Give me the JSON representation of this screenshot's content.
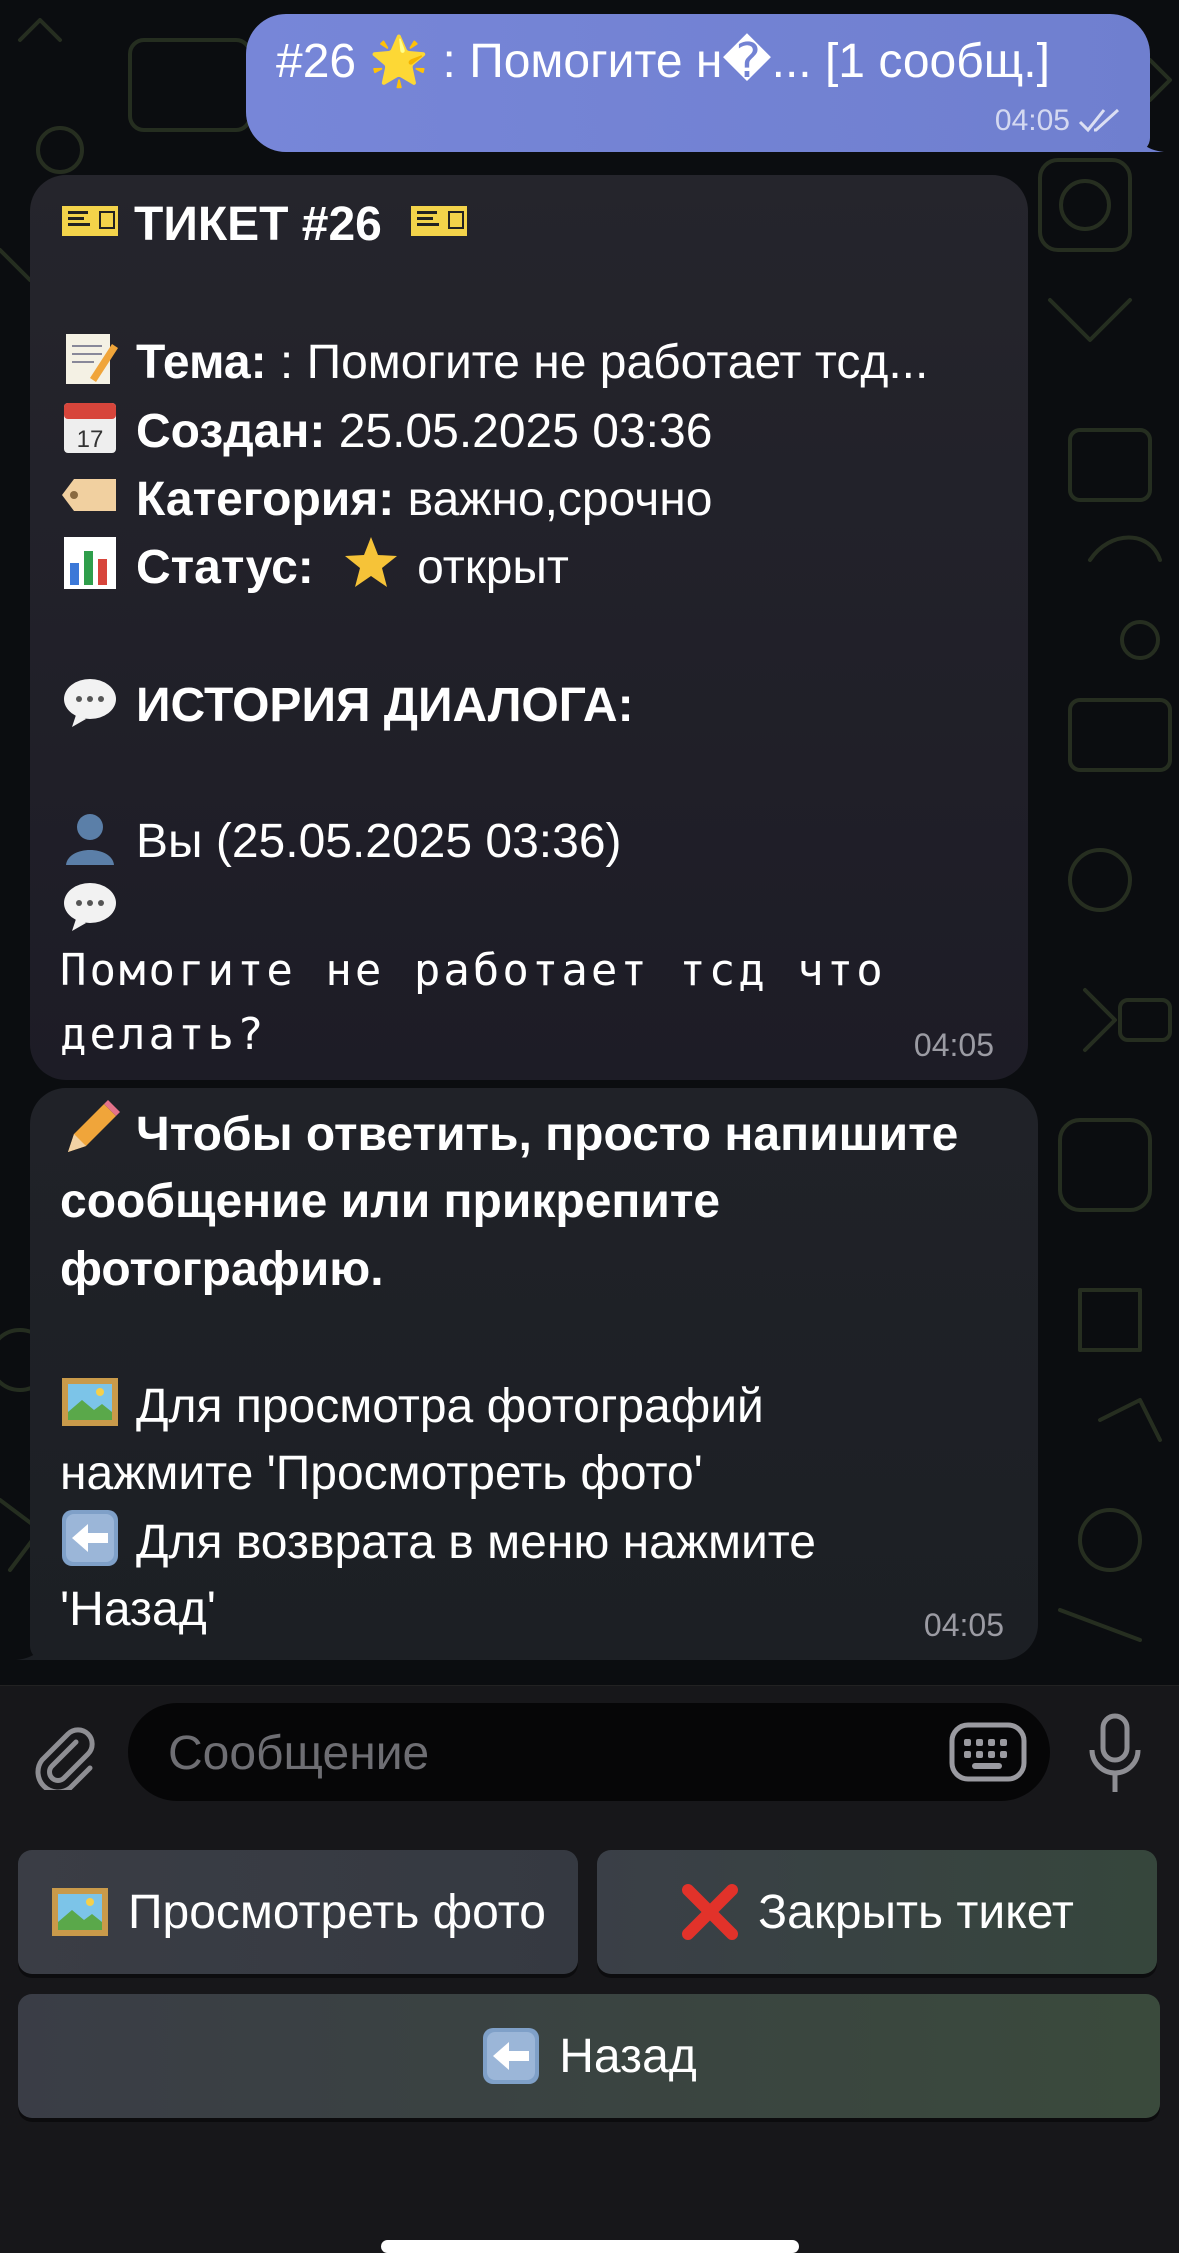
{
  "outgoing": {
    "text": "#26 🌟 : Помогите н�... [1 сообщ.]",
    "time": "04:05",
    "status_icon": "double-check-icon"
  },
  "ticket_message": {
    "title": "ТИКЕТ #26",
    "subject_label": "Тема:",
    "subject_value": ": Помогите не работает тсд...",
    "created_label": "Создан:",
    "created_value": "25.05.2025 03:36",
    "category_label": "Категория:",
    "category_value": "важно,срочно",
    "status_label": "Статус:",
    "status_value": "открыт",
    "history_label": "ИСТОРИЯ ДИАЛОГА:",
    "author_line": "Вы (25.05.2025 03:36)",
    "message_line1": "Помогите не работает тсд что",
    "message_line2": "делать?",
    "time": "04:05"
  },
  "help_message": {
    "line1": "Чтобы ответить, просто напишите",
    "line2": "сообщение или прикрепите",
    "line3": "фотографию.",
    "photo_line1": "Для просмотра фотографий",
    "photo_line2": "нажмите 'Просмотреть фото'",
    "back_line1": "Для возврата в меню нажмите",
    "back_line2": "'Назад'",
    "time": "04:05"
  },
  "composer": {
    "placeholder": "Сообщение"
  },
  "keyboard": {
    "view_photo": "Просмотреть фото",
    "close_ticket": "Закрыть тикет",
    "back": "Назад"
  }
}
